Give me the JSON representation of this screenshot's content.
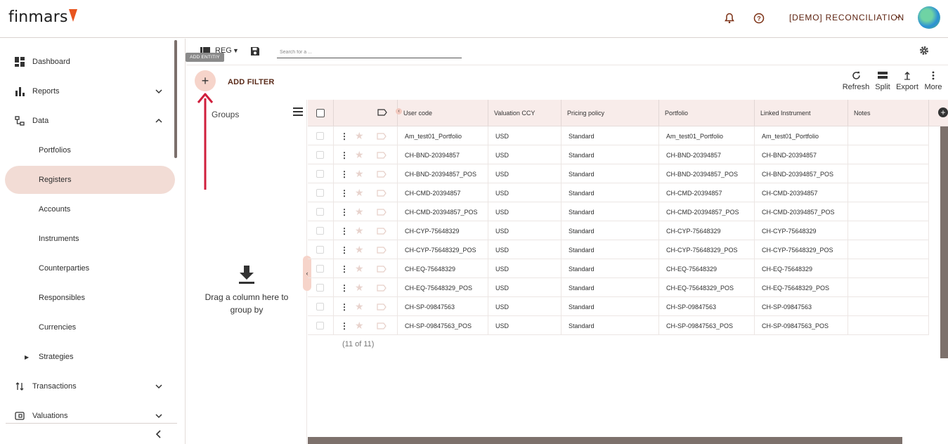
{
  "header": {
    "logo": "finmars",
    "workspace": "[DEMO] RECONCILIATION",
    "icons": [
      "bell-icon",
      "help-icon",
      "chevron-down-icon"
    ]
  },
  "sidebar": {
    "items": [
      {
        "label": "Dashboard",
        "icon": "dashboard-icon"
      },
      {
        "label": "Reports",
        "icon": "bar-chart-icon"
      },
      {
        "label": "Data",
        "icon": "data-icon"
      },
      {
        "label": "Portfolios"
      },
      {
        "label": "Registers"
      },
      {
        "label": "Accounts"
      },
      {
        "label": "Instruments"
      },
      {
        "label": "Counterparties"
      },
      {
        "label": "Responsibles"
      },
      {
        "label": "Currencies"
      },
      {
        "label": "Strategies"
      },
      {
        "label": "Transactions",
        "icon": "transactions-icon"
      },
      {
        "label": "Valuations",
        "icon": "valuations-icon"
      }
    ]
  },
  "toolbar": {
    "layout_name": "REG",
    "search_placeholder": "Search for a ...",
    "tooltip": "ADD ENTITIY",
    "add_filter": "ADD FILTER",
    "actions": {
      "refresh": "Refresh",
      "split": "Split",
      "export": "Export",
      "more": "More"
    }
  },
  "groups": {
    "title": "Groups",
    "drag_hint": "Drag a column here to group by"
  },
  "table": {
    "columns": [
      "User code",
      "Valuation CCY",
      "Pricing policy",
      "Portfolio",
      "Linked Instrument",
      "Notes"
    ],
    "rows": [
      [
        "Am_test01_Portfolio",
        "USD",
        "Standard",
        "Am_test01_Portfolio",
        "Am_test01_Portfolio",
        ""
      ],
      [
        "CH-BND-20394857",
        "USD",
        "Standard",
        "CH-BND-20394857",
        "CH-BND-20394857",
        ""
      ],
      [
        "CH-BND-20394857_POS",
        "USD",
        "Standard",
        "CH-BND-20394857_POS",
        "CH-BND-20394857_POS",
        ""
      ],
      [
        "CH-CMD-20394857",
        "USD",
        "Standard",
        "CH-CMD-20394857",
        "CH-CMD-20394857",
        ""
      ],
      [
        "CH-CMD-20394857_POS",
        "USD",
        "Standard",
        "CH-CMD-20394857_POS",
        "CH-CMD-20394857_POS",
        ""
      ],
      [
        "CH-CYP-75648329",
        "USD",
        "Standard",
        "CH-CYP-75648329",
        "CH-CYP-75648329",
        ""
      ],
      [
        "CH-CYP-75648329_POS",
        "USD",
        "Standard",
        "CH-CYP-75648329_POS",
        "CH-CYP-75648329_POS",
        ""
      ],
      [
        "CH-EQ-75648329",
        "USD",
        "Standard",
        "CH-EQ-75648329",
        "CH-EQ-75648329",
        ""
      ],
      [
        "CH-EQ-75648329_POS",
        "USD",
        "Standard",
        "CH-EQ-75648329_POS",
        "CH-EQ-75648329_POS",
        ""
      ],
      [
        "CH-SP-09847563",
        "USD",
        "Standard",
        "CH-SP-09847563",
        "CH-SP-09847563",
        ""
      ],
      [
        "CH-SP-09847563_POS",
        "USD",
        "Standard",
        "CH-SP-09847563_POS",
        "CH-SP-09847563_POS",
        ""
      ]
    ],
    "count": "(11 of 11)"
  },
  "colors": {
    "accent": "#f6d4ca",
    "active_nav": "#f2dcd5",
    "brand": "#e8551f",
    "annotation": "#d01f3c"
  }
}
